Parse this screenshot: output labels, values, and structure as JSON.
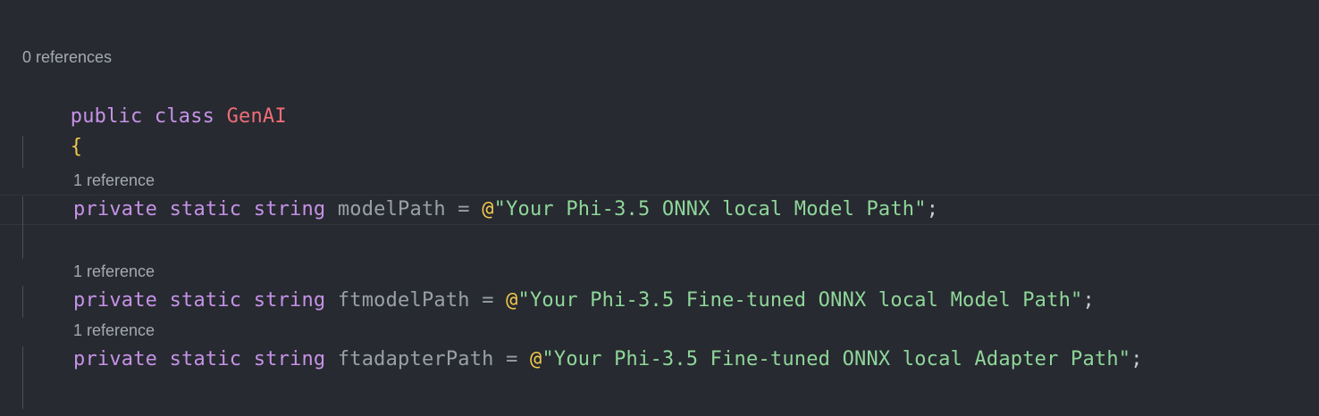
{
  "class_block": {
    "lens": "0 references",
    "keyword_public": "public",
    "keyword_class": "class",
    "class_name": "GenAI",
    "open_brace": "{"
  },
  "fields": [
    {
      "lens": "1 reference",
      "modifier_private": "private",
      "modifier_static": "static",
      "type": "string",
      "name": "modelPath",
      "equals": "=",
      "at": "@",
      "value": "\"Your Phi-3.5 ONNX local Model Path\"",
      "semicolon": ";"
    },
    {
      "lens": "1 reference",
      "modifier_private": "private",
      "modifier_static": "static",
      "type": "string",
      "name": "ftmodelPath",
      "equals": "=",
      "at": "@",
      "value": "\"Your Phi-3.5 Fine-tuned ONNX local Model Path\"",
      "semicolon": ";"
    },
    {
      "lens": "1 reference",
      "modifier_private": "private",
      "modifier_static": "static",
      "type": "string",
      "name": "ftadapterPath",
      "equals": "=",
      "at": "@",
      "value": "\"Your Phi-3.5 Fine-tuned ONNX local Adapter Path\"",
      "semicolon": ";"
    }
  ]
}
